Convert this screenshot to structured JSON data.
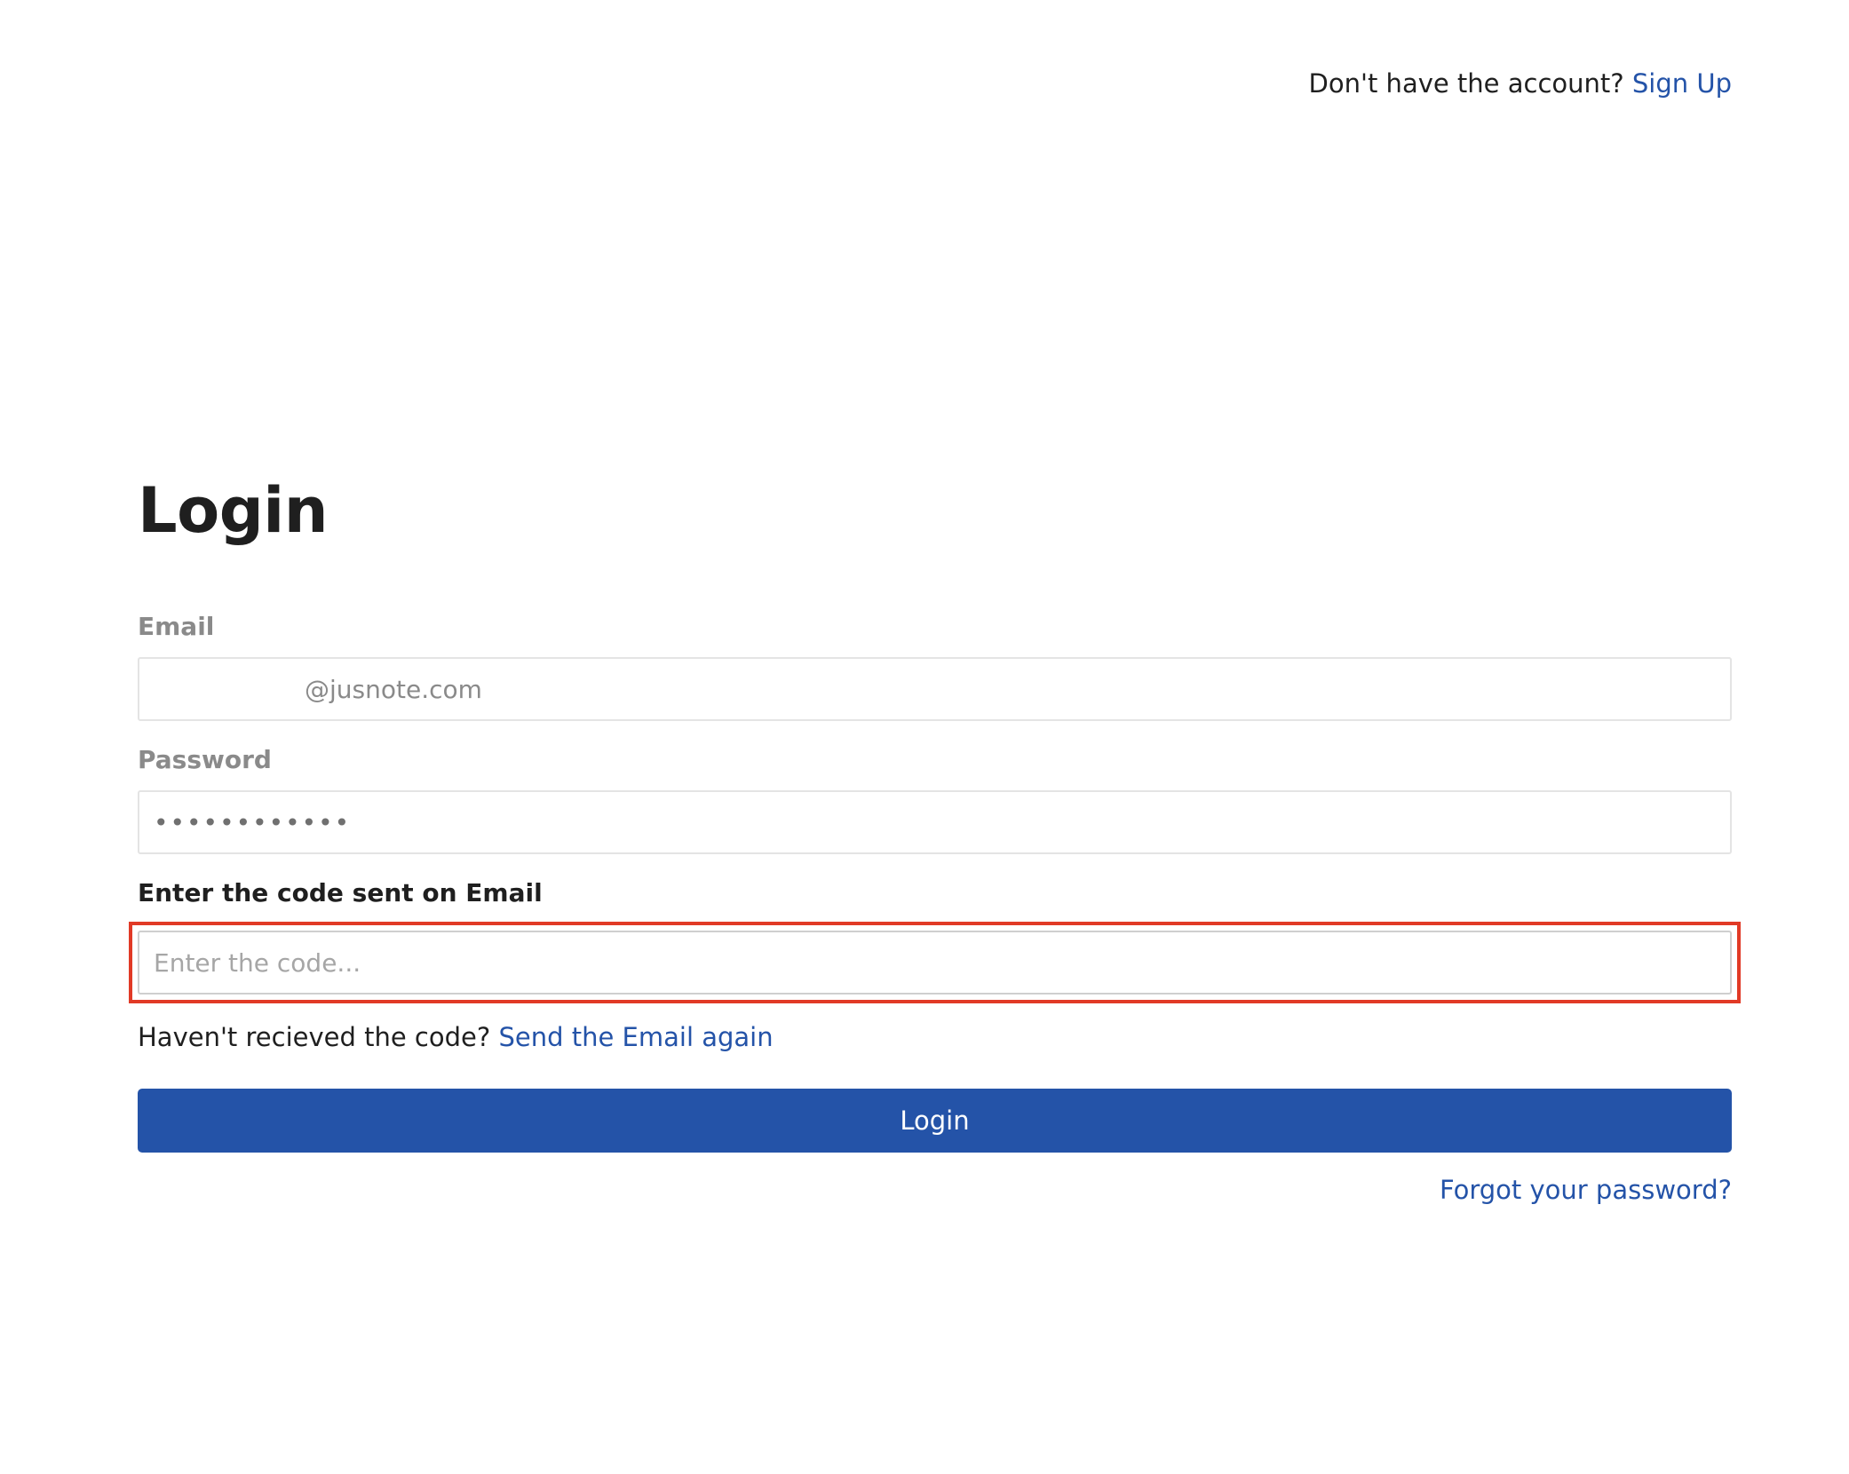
{
  "header": {
    "signup_prompt": "Don't have the account?",
    "signup_link": "Sign Up"
  },
  "login_form": {
    "title": "Login",
    "email": {
      "label": "Email",
      "value": "@jusnote.com"
    },
    "password": {
      "label": "Password",
      "value": "••••••••••••"
    },
    "code": {
      "label": "Enter the code sent on Email",
      "placeholder": "Enter the code...",
      "value": ""
    },
    "resend": {
      "prompt": "Haven't recieved the code?",
      "link": "Send the Email again"
    },
    "login_button": "Login",
    "forgot_link": "Forgot your password?"
  },
  "colors": {
    "brand_blue": "#2453a8",
    "highlight_red": "#e13a26",
    "label_gray": "#8a8a8a"
  }
}
